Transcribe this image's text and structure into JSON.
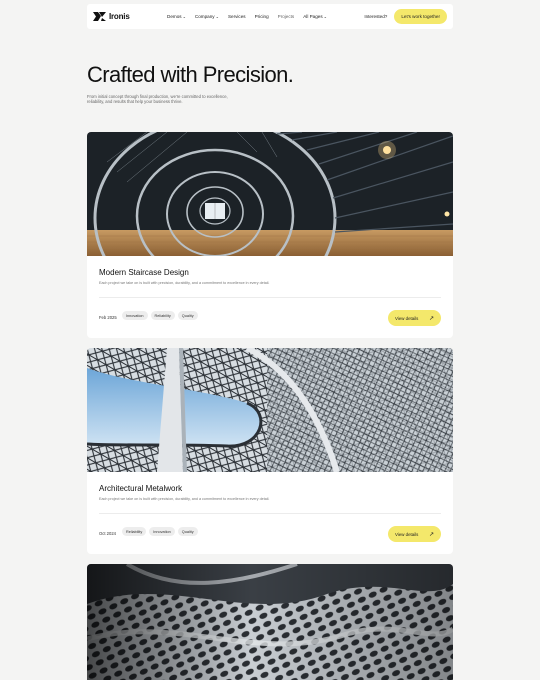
{
  "brand": {
    "name": "Ironis"
  },
  "nav": {
    "items": [
      {
        "label": "Demos",
        "has_dropdown": true
      },
      {
        "label": "Company",
        "has_dropdown": true
      },
      {
        "label": "Services",
        "has_dropdown": false
      },
      {
        "label": "Pricing",
        "has_dropdown": false
      },
      {
        "label": "Projects",
        "has_dropdown": false
      },
      {
        "label": "All Pages",
        "has_dropdown": true
      }
    ],
    "interested": "Interested?",
    "cta": "Let's work together",
    "dropdown_glyph": "⌄"
  },
  "hero": {
    "title": "Crafted with Precision.",
    "subtitle": "From initial concept through final production, we're committed to excellence, reliability, and results that help your business thrive."
  },
  "projects": [
    {
      "title": "Modern Staircase Design",
      "description": "Each project we take on is built with precision, durability, and a commitment to excellence in every detail.",
      "date": "Feb 2025",
      "tags": [
        "Innovation",
        "Reliability",
        "Quality"
      ],
      "button": "View details",
      "image": "spiral-staircase-photo"
    },
    {
      "title": "Architectural Metalwork",
      "description": "Each project we take on is built with precision, durability, and a commitment to excellence in every detail.",
      "date": "Oct 2024",
      "tags": [
        "Reliability",
        "Innovation",
        "Quality"
      ],
      "button": "View details",
      "image": "steel-lattice-canopy-photo"
    },
    {
      "image": "perforated-metal-sculpture-photo"
    }
  ],
  "icons": {
    "arrow": "↗"
  },
  "colors": {
    "accent": "#f4e86b",
    "background": "#f4f4f3",
    "card": "#ffffff"
  }
}
